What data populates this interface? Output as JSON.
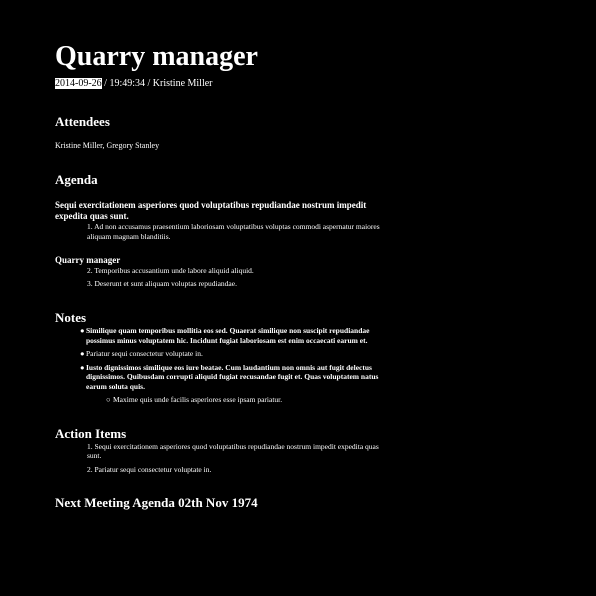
{
  "title": "Quarry manager",
  "meta": {
    "date": "2014-09-26",
    "rest": " / 19:49:34 / Kristine Miller"
  },
  "attendees": {
    "heading": "Attendees",
    "names": "Kristine Miller, Gregory Stanley"
  },
  "agenda": {
    "heading": "Agenda",
    "intro": "Sequi exercitationem asperiores quod voluptatibus repudiandae nostrum impedit expedita quas sunt.",
    "items_1": [
      {
        "num": "1.",
        "text": "Ad non accusamus praesentium laboriosam voluptatibus voluptas commodi aspernatur maiores aliquam magnam blanditiis."
      }
    ],
    "subheading": "Quarry manager",
    "items_2": [
      {
        "num": "2.",
        "text": "Temporibus accusantium unde labore aliquid aliquid."
      },
      {
        "num": "3.",
        "text": "Deserunt et sunt aliquam voluptas repudiandae."
      }
    ]
  },
  "notes": {
    "heading": "Notes",
    "items": [
      {
        "text": "Similique quam temporibus mollitia eos sed. Quaerat similique non suscipit repudiandae possimus minus voluptatem hic. Incidunt fugiat laboriosam est enim occaecati earum et."
      },
      {
        "text": "Pariatur sequi consectetur voluptate in."
      },
      {
        "text": "Iusto dignissimos similique eos iure beatae. Cum laudantium non omnis aut fugit delectus dignissimos. Quibusdam corrupti aliquid fugiat recusandae fugit et. Quas voluptatem natus earum soluta quis."
      }
    ],
    "sub_item": "Maxime quis unde facilis asperiores esse ipsam pariatur."
  },
  "actions": {
    "heading": "Action Items",
    "items": [
      {
        "num": "1.",
        "text": "Sequi exercitationem asperiores quod voluptatibus repudiandae nostrum impedit expedita quas sunt."
      },
      {
        "num": "2.",
        "text": "Pariatur sequi consectetur voluptate in."
      }
    ]
  },
  "next_meeting": {
    "heading": "Next Meeting Agenda 02th Nov 1974"
  }
}
